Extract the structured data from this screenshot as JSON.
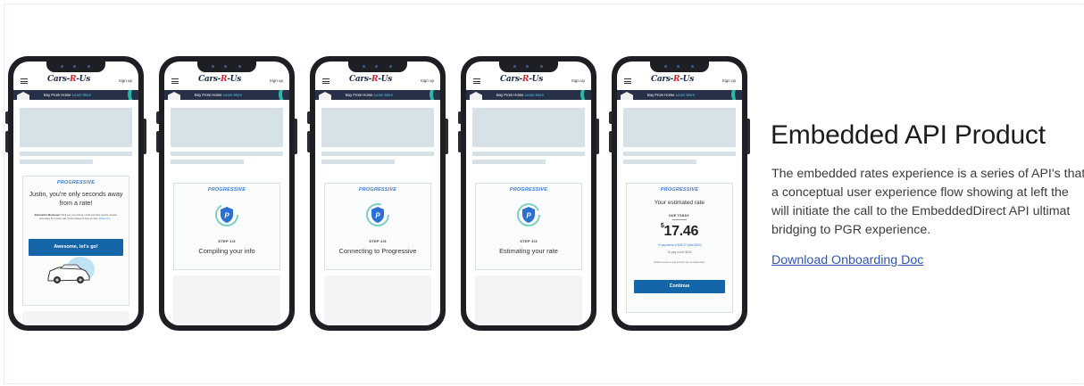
{
  "phone_common": {
    "logo_left": "Cars-",
    "logo_mid": "R",
    "logo_right": "-Us",
    "signup": "Sign up",
    "banner_text": "Buy From Home",
    "banner_link": "Learn More",
    "progressive": "PROGRESSIVE"
  },
  "phone1": {
    "greeting": "Justin, you're only seconds away from a rate!",
    "disclosure_label": "Information Disclosure:",
    "disclosure_text": "We'll use your driving, credit and other reports. Answer accurately for a lower rate. Prices based on how you buy.",
    "read_more": "Read more...",
    "cta": "Awesome, let's go!"
  },
  "phone2": {
    "step": "STEP 1/3",
    "text": "Compiling your info"
  },
  "phone3": {
    "step": "STEP 2/3",
    "text": "Connecting to Progressive"
  },
  "phone4": {
    "step": "STEP 3/3",
    "text": "Estimating your rate"
  },
  "phone5": {
    "label": "Your estimated rate",
    "due": "DUE TODAY:",
    "currency": "$",
    "price": "17.46",
    "payments": "+5 payments of $48.57 (total $260)",
    "payinfull": "Or pay in full: $243",
    "note": "Additional drivers and vehicles can be added later.",
    "cta": "Continue"
  },
  "content": {
    "heading": "Embedded API Product",
    "desc_lines": [
      "The embedded rates experience is a series of API's that",
      "a conceptual user experience flow showing at left the",
      "will initiate the call to the EmbeddedDirect API ultimat",
      "bridging to PGR experience."
    ],
    "download_link": "Download Onboarding Doc"
  },
  "colors": {
    "accent_blue": "#1466a8",
    "brand_blue": "#3c7bd6",
    "placeholder": "#d6e2e7",
    "banner": "#263147",
    "teal": "#27b8a8"
  },
  "icons": [
    "hamburger-icon",
    "progressive-shield-icon",
    "house-icon",
    "car-icon"
  ]
}
